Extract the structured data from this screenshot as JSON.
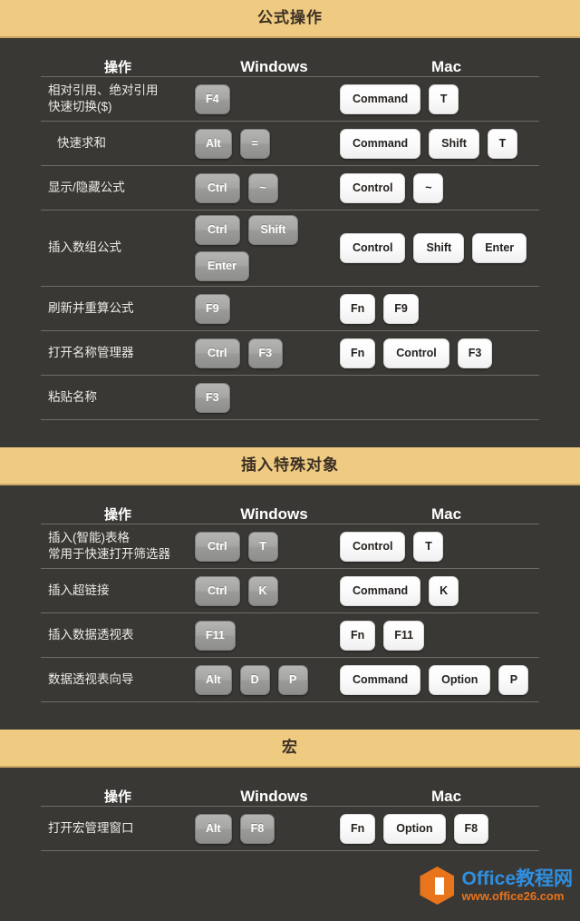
{
  "page": {
    "background_color": "#3a3835",
    "banner_color": "#efca81",
    "banner_text_color": "#3b3024"
  },
  "columns": {
    "operation": "操作",
    "windows": "Windows",
    "mac": "Mac"
  },
  "sections": [
    {
      "title": "公式操作",
      "rows": [
        {
          "label_line1": "相对引用、绝对引用",
          "label_line2": "快速切换($)",
          "windows": [
            "F4"
          ],
          "mac": [
            "Command",
            "T"
          ]
        },
        {
          "label_line1": "快速求和",
          "label_line2": "",
          "windows": [
            "Alt",
            "="
          ],
          "mac": [
            "Command",
            "Shift",
            "T"
          ]
        },
        {
          "label_line1": "显示/隐藏公式",
          "label_line2": "",
          "windows": [
            "Ctrl",
            "~"
          ],
          "mac": [
            "Control",
            "~"
          ]
        },
        {
          "label_line1": "插入数组公式",
          "label_line2": "",
          "windows": [
            "Ctrl",
            "Shift",
            "Enter"
          ],
          "mac": [
            "Control",
            "Shift",
            "Enter"
          ]
        },
        {
          "label_line1": "刷新并重算公式",
          "label_line2": "",
          "windows": [
            "F9"
          ],
          "mac": [
            "Fn",
            "F9"
          ]
        },
        {
          "label_line1": "打开名称管理器",
          "label_line2": "",
          "windows": [
            "Ctrl",
            "F3"
          ],
          "mac": [
            "Fn",
            "Control",
            "F3"
          ]
        },
        {
          "label_line1": "粘贴名称",
          "label_line2": "",
          "windows": [
            "F3"
          ],
          "mac": []
        }
      ]
    },
    {
      "title": "插入特殊对象",
      "rows": [
        {
          "label_line1": "插入(智能)表格",
          "label_line2": "常用于快速打开筛选器",
          "windows": [
            "Ctrl",
            "T"
          ],
          "mac": [
            "Control",
            "T"
          ]
        },
        {
          "label_line1": "插入超链接",
          "label_line2": "",
          "windows": [
            "Ctrl",
            "K"
          ],
          "mac": [
            "Command",
            "K"
          ]
        },
        {
          "label_line1": "插入数据透视表",
          "label_line2": "",
          "windows": [
            "F11"
          ],
          "mac": [
            "Fn",
            "F11"
          ]
        },
        {
          "label_line1": "数据透视表向导",
          "label_line2": "",
          "windows": [
            "Alt",
            "D",
            "P"
          ],
          "mac": [
            "Command",
            "Option",
            "P"
          ]
        }
      ]
    },
    {
      "title": "宏",
      "rows": [
        {
          "label_line1": "打开宏管理窗口",
          "label_line2": "",
          "windows": [
            "Alt",
            "F8"
          ],
          "mac": [
            "Fn",
            "Option",
            "F8"
          ]
        }
      ]
    }
  ],
  "watermark": {
    "title": "Office教程网",
    "url": "www.office26.com",
    "logo_color": "#e8741c",
    "title_color": "#2f8fe0"
  }
}
